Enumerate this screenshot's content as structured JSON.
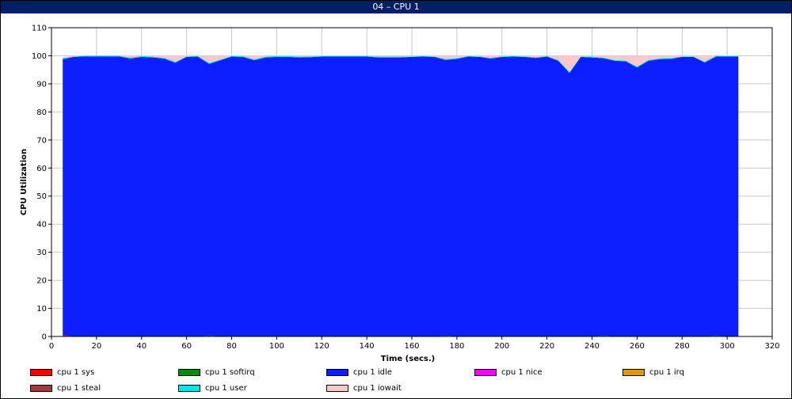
{
  "window": {
    "title": "04 – CPU 1"
  },
  "chart_data": {
    "type": "area",
    "title": "",
    "xlabel": "Time (secs.)",
    "ylabel": "CPU Utilization",
    "xlim": [
      0,
      320
    ],
    "ylim": [
      0,
      110
    ],
    "x_ticks": [
      "0",
      "20",
      "40",
      "60",
      "80",
      "100",
      "120",
      "140",
      "160",
      "180",
      "200",
      "220",
      "240",
      "260",
      "280",
      "300",
      "320"
    ],
    "y_ticks": [
      "0",
      "10",
      "20",
      "30",
      "40",
      "50",
      "60",
      "70",
      "80",
      "90",
      "100",
      "110"
    ],
    "grid": true,
    "legend_position": "bottom",
    "x": [
      5,
      10,
      15,
      20,
      25,
      30,
      35,
      40,
      45,
      50,
      55,
      60,
      65,
      70,
      75,
      80,
      85,
      90,
      95,
      100,
      105,
      110,
      115,
      120,
      125,
      130,
      135,
      140,
      145,
      150,
      155,
      160,
      165,
      170,
      175,
      180,
      185,
      190,
      195,
      200,
      205,
      210,
      215,
      220,
      225,
      230,
      235,
      240,
      245,
      250,
      255,
      260,
      265,
      270,
      275,
      280,
      285,
      290,
      295,
      300,
      305
    ],
    "series": [
      {
        "name": "cpu 1 sys",
        "color": "#ff0000",
        "values": [
          0.5,
          0,
          0,
          0,
          0,
          0,
          0,
          0,
          0,
          0,
          0,
          0,
          0,
          0,
          0,
          0,
          0,
          0,
          0,
          0,
          0,
          0,
          0,
          0,
          0,
          0,
          0,
          0,
          0,
          0,
          0,
          0,
          0,
          0,
          0,
          0,
          0,
          0,
          0,
          0,
          0,
          0,
          0,
          0,
          0,
          0,
          0,
          0,
          0,
          0,
          0,
          0,
          0,
          0,
          0,
          0,
          0,
          0,
          0,
          0,
          0
        ]
      },
      {
        "name": "cpu 1 softirq",
        "color": "#008c00",
        "values": [
          0,
          0,
          0,
          0,
          0,
          0,
          0,
          0,
          0,
          0,
          0,
          0,
          0,
          0.3,
          0,
          0,
          0,
          0,
          0,
          0,
          0,
          0,
          0,
          0,
          0,
          0,
          0,
          0,
          0,
          0,
          0,
          0,
          0,
          0,
          0.3,
          0,
          0,
          0,
          0,
          0,
          0,
          0,
          0,
          0,
          0,
          0,
          0,
          0,
          0.3,
          0,
          0,
          0,
          0,
          0,
          0,
          0,
          0,
          0,
          0.3,
          0,
          0
        ]
      },
      {
        "name": "cpu 1 idle",
        "color": "#0a1eff",
        "values": [
          98.3,
          99.6,
          99.8,
          99.7,
          99.7,
          99.8,
          99,
          99.6,
          99.4,
          99,
          97.5,
          99.6,
          99.7,
          96.8,
          98.4,
          99.7,
          99.6,
          98.4,
          99.4,
          99.6,
          99.6,
          99.4,
          99.5,
          99.7,
          99.7,
          99.7,
          99.7,
          99.7,
          99.4,
          99.4,
          99.4,
          99.6,
          99.7,
          99.6,
          98.2,
          98.9,
          99.7,
          99.6,
          99,
          99.6,
          99.7,
          99.6,
          99.2,
          99.7,
          98.2,
          93.9,
          99.6,
          99.4,
          98.8,
          98.2,
          98,
          95.8,
          98.2,
          98.8,
          98.9,
          99.6,
          99.6,
          97.6,
          99.4,
          99.7,
          99.7
        ]
      },
      {
        "name": "cpu 1 nice",
        "color": "#ff00ff",
        "values": [
          0,
          0,
          0,
          0,
          0,
          0,
          0,
          0,
          0,
          0,
          0,
          0,
          0,
          0,
          0,
          0,
          0,
          0,
          0,
          0,
          0,
          0,
          0,
          0,
          0,
          0,
          0,
          0,
          0,
          0,
          0,
          0,
          0,
          0,
          0,
          0,
          0,
          0,
          0,
          0,
          0,
          0,
          0,
          0,
          0,
          0,
          0,
          0,
          0,
          0,
          0,
          0,
          0,
          0,
          0,
          0,
          0,
          0,
          0,
          0,
          0
        ]
      },
      {
        "name": "cpu 1 irq",
        "color": "#e0960a",
        "values": [
          0,
          0,
          0,
          0,
          0,
          0,
          0,
          0,
          0,
          0,
          0,
          0,
          0,
          0,
          0,
          0,
          0,
          0,
          0,
          0,
          0,
          0,
          0,
          0,
          0,
          0,
          0,
          0,
          0,
          0,
          0,
          0,
          0,
          0,
          0,
          0,
          0,
          0,
          0,
          0,
          0,
          0,
          0,
          0,
          0,
          0,
          0,
          0,
          0,
          0,
          0,
          0,
          0,
          0,
          0,
          0,
          0,
          0,
          0,
          0,
          0
        ]
      },
      {
        "name": "cpu 1 steal",
        "color": "#a33b3b",
        "values": [
          0,
          0,
          0,
          0,
          0,
          0,
          0,
          0,
          0,
          0,
          0,
          0,
          0,
          0,
          0,
          0,
          0,
          0,
          0,
          0,
          0,
          0,
          0,
          0,
          0,
          0,
          0,
          0,
          0,
          0,
          0,
          0,
          0,
          0,
          0,
          0,
          0,
          0,
          0,
          0,
          0,
          0,
          0,
          0,
          0,
          0,
          0,
          0,
          0,
          0,
          0,
          0,
          0,
          0,
          0,
          0,
          0,
          0,
          0,
          0,
          0
        ]
      },
      {
        "name": "cpu 1 user",
        "color": "#00e5e5",
        "values": [
          0.4,
          0.2,
          0.2,
          0.3,
          0.3,
          0.2,
          0.4,
          0.3,
          0.3,
          0.3,
          0.4,
          0.2,
          0.2,
          0.4,
          0.3,
          0.2,
          0.3,
          0.4,
          0.3,
          0.3,
          0.3,
          0.3,
          0.3,
          0.2,
          0.2,
          0.2,
          0.2,
          0.2,
          0.3,
          0.3,
          0.3,
          0.2,
          0.2,
          0.2,
          0.4,
          0.3,
          0.2,
          0.2,
          0.3,
          0.2,
          0.2,
          0.2,
          0.3,
          0.2,
          0.3,
          0.4,
          0.2,
          0.3,
          0.3,
          0.3,
          0.3,
          0.4,
          0.3,
          0.3,
          0.3,
          0.2,
          0.2,
          0.3,
          0.3,
          0.2,
          0.2
        ]
      },
      {
        "name": "cpu 1 iowait",
        "color": "#ffc8c8",
        "values": [
          0.3,
          0.2,
          0,
          0,
          0,
          0,
          0.6,
          0.1,
          0.3,
          0.7,
          2.1,
          0.2,
          0.1,
          2.5,
          1.3,
          0.1,
          0.1,
          1.2,
          0.3,
          0.1,
          0.1,
          0.3,
          0.2,
          0.1,
          0.1,
          0.1,
          0.1,
          0.1,
          0.3,
          0.3,
          0.3,
          0.2,
          0.1,
          0.2,
          1.1,
          0.8,
          0.1,
          0.2,
          0.7,
          0.2,
          0.1,
          0.2,
          0.5,
          0.1,
          1.5,
          5.7,
          0.2,
          0.3,
          0.6,
          1.5,
          1.7,
          3.8,
          1.5,
          0.9,
          0.8,
          0.2,
          0.2,
          1.8,
          0.3,
          0.1,
          0.1
        ]
      }
    ]
  },
  "legend_layout_order": [
    0,
    1,
    2,
    3,
    4,
    5,
    6,
    7
  ]
}
